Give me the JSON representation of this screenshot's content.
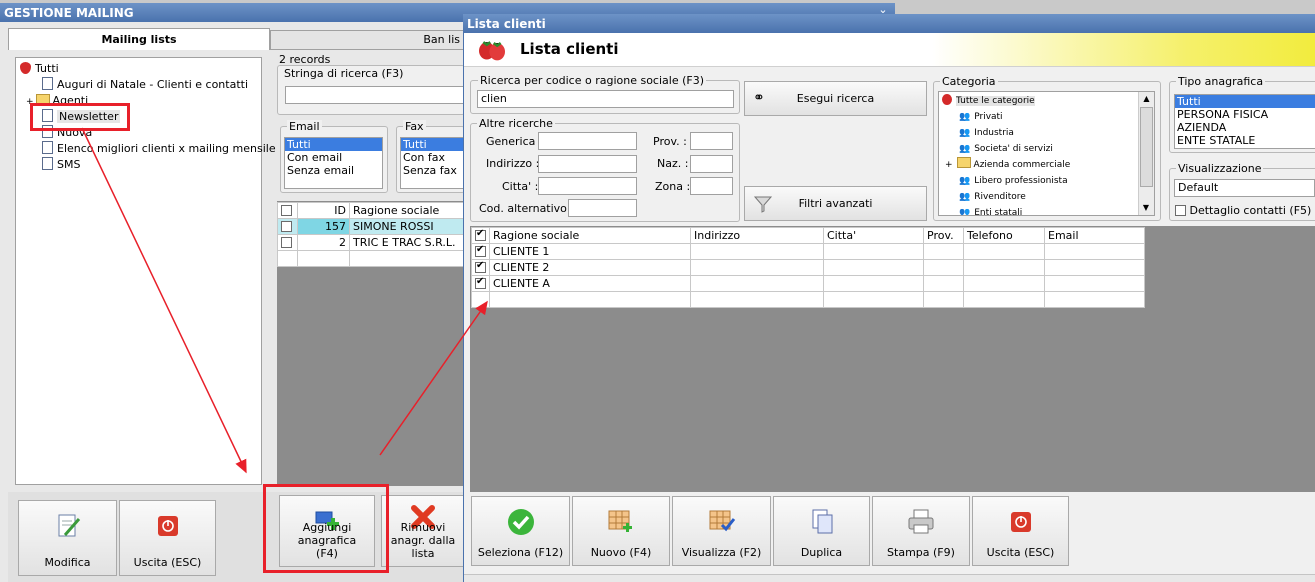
{
  "main_window": {
    "title": "GESTIONE MAILING",
    "tabs": [
      "Mailing lists",
      "Ban lis"
    ]
  },
  "tree": {
    "root": "Tutti",
    "items": [
      "Auguri di Natale - Clienti e contatti",
      "Agenti",
      "Newsletter",
      "Nuova",
      "Elenco migliori clienti x mailing mensile",
      "SMS"
    ]
  },
  "records_label": "2 records",
  "search": {
    "label": "Stringa di ricerca (F3)",
    "value": ""
  },
  "email_filter": {
    "label": "Email",
    "options": [
      "Tutti",
      "Con email",
      "Senza email"
    ]
  },
  "fax_filter": {
    "label": "Fax",
    "options": [
      "Tutti",
      "Con fax",
      "Senza fax"
    ]
  },
  "main_grid": {
    "headers": [
      "ID",
      "Ragione sociale"
    ],
    "rows": [
      {
        "id": "157",
        "name": "SIMONE ROSSI"
      },
      {
        "id": "2",
        "name": "TRIC E TRAC S.R.L."
      }
    ]
  },
  "main_buttons": {
    "modifica": "Modifica",
    "uscita": "Uscita (ESC)",
    "aggiungi": "Aggiungi anagrafica (F4)",
    "rimuovi": "Rimuovi anagr. dalla lista"
  },
  "dialog": {
    "title": "Lista clienti",
    "header": "Lista clienti",
    "search_group": "Ricerca per codice o ragione sociale (F3)",
    "search_value": "clien",
    "other_group": "Altre ricerche",
    "labels": {
      "generica": "Generica :",
      "indirizzo": "Indirizzo :",
      "citta": "Citta' :",
      "cod": "Cod. alternativo :",
      "prov": "Prov. :",
      "naz": "Naz. :",
      "zona": "Zona :"
    },
    "esegui": "Esegui ricerca",
    "filtri": "Filtri avanzati",
    "categoria": {
      "label": "Categoria",
      "items": [
        "Tutte le categorie",
        "Privati",
        "Industria",
        "Societa' di servizi",
        "Azienda commerciale",
        "Libero professionista",
        "Rivenditore",
        "Enti statali"
      ]
    },
    "tipo": {
      "label": "Tipo anagrafica",
      "items": [
        "Tutti",
        "PERSONA FISICA",
        "AZIENDA",
        "ENTE STATALE"
      ]
    },
    "visualizzazione": {
      "label": "Visualizzazione",
      "value": "Default"
    },
    "dettaglio": "Dettaglio contatti (F5)",
    "grid": {
      "headers": [
        "Ragione sociale",
        "Indirizzo",
        "Citta'",
        "Prov.",
        "Telefono",
        "Email"
      ],
      "rows": [
        "CLIENTE 1",
        "CLIENTE 2",
        "CLIENTE A"
      ]
    },
    "buttons": [
      "Seleziona (F12)",
      "Nuovo (F4)",
      "Visualizza (F2)",
      "Duplica",
      "Stampa (F9)",
      "Uscita (ESC)"
    ]
  },
  "colors": {
    "annotation_red": "#e8202a",
    "title_blue": "#4a72ad",
    "selection": "#3b7de0"
  }
}
